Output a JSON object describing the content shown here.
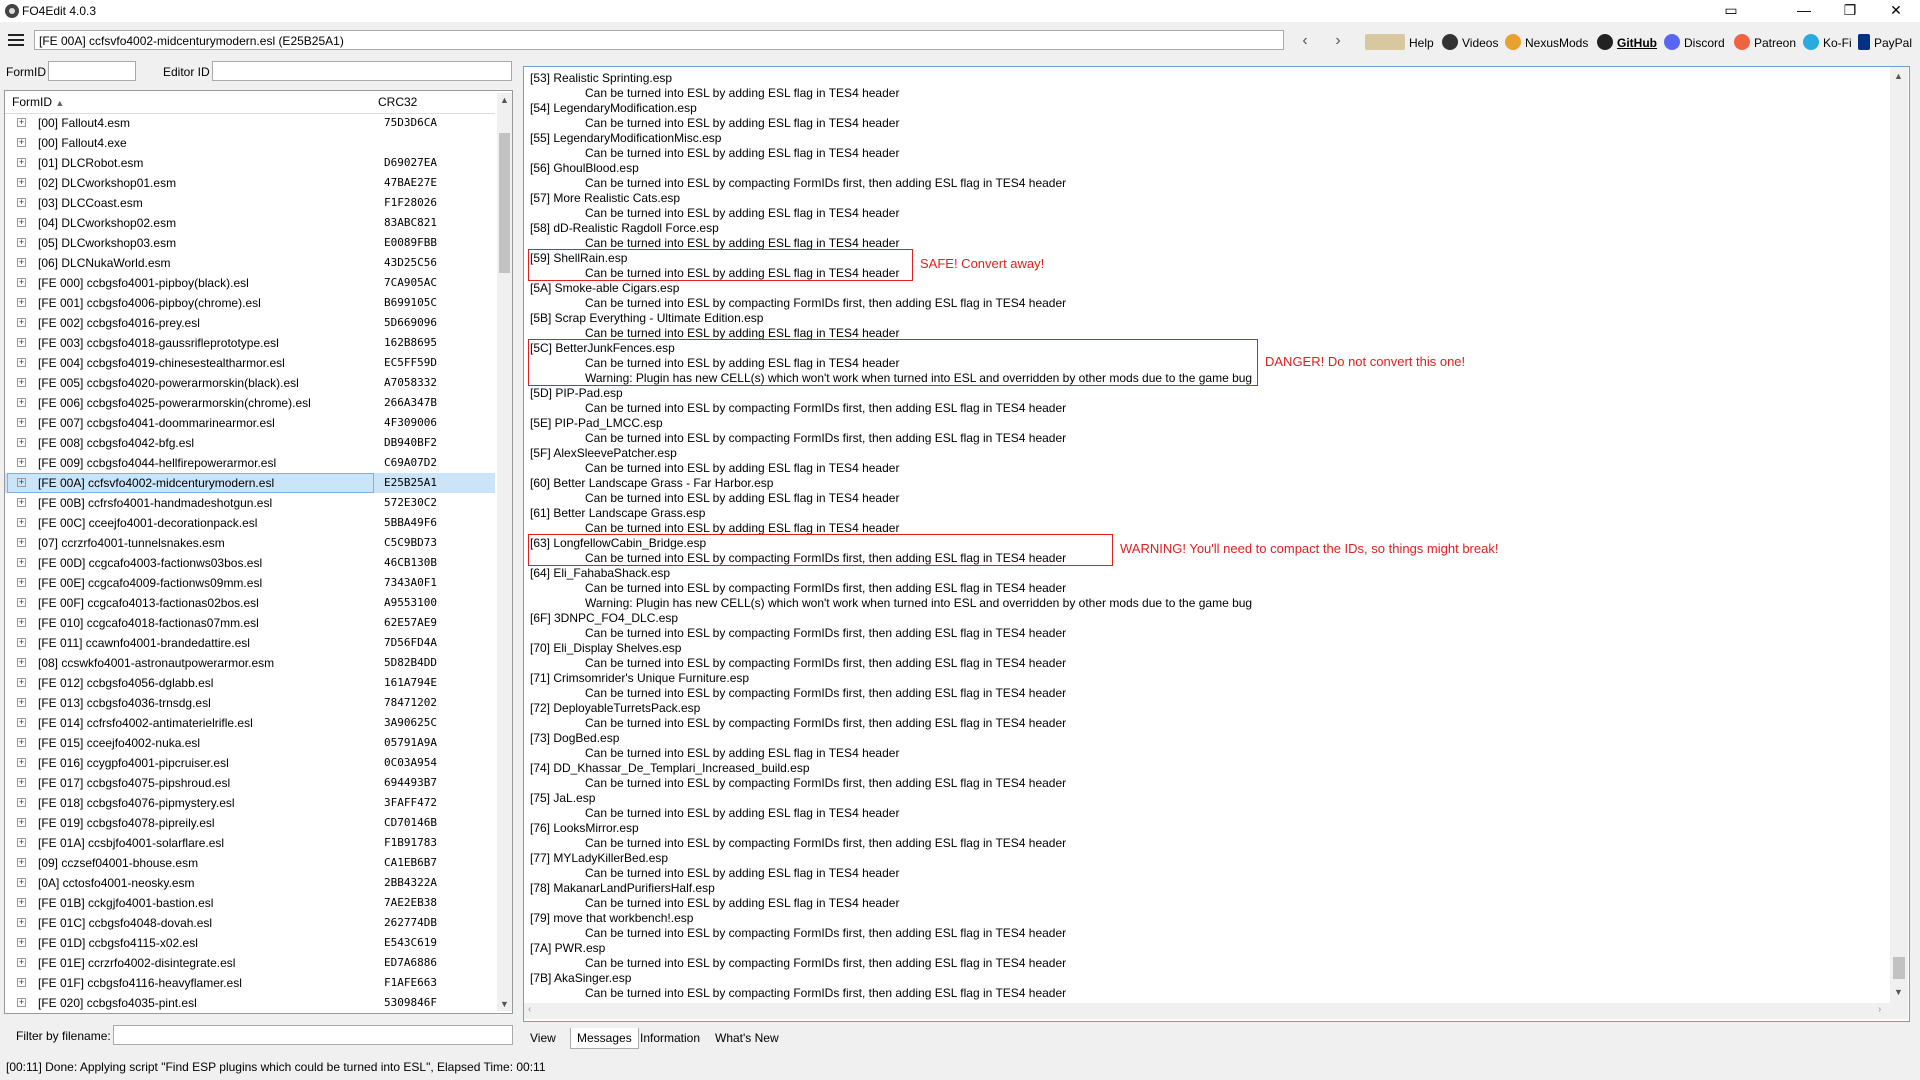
{
  "window": {
    "title": "FO4Edit 4.0.3"
  },
  "toolbar": {
    "path": "[FE 00A] ccfsvfo4002-midcenturymodern.esl (E25B25A1)",
    "links": [
      {
        "label": "Help",
        "icon": "book-icon"
      },
      {
        "label": "Videos",
        "icon": "video-icon"
      },
      {
        "label": "NexusMods",
        "icon": "nexusmods-icon"
      },
      {
        "label": "GitHub",
        "icon": "github-icon"
      },
      {
        "label": "Discord",
        "icon": "discord-icon"
      },
      {
        "label": "Patreon",
        "icon": "patreon-icon"
      },
      {
        "label": "Ko-Fi",
        "icon": "kofi-icon"
      },
      {
        "label": "PayPal",
        "icon": "paypal-icon"
      }
    ]
  },
  "filters": {
    "formid_label": "FormID",
    "editorid_label": "Editor ID",
    "filename_label": "Filter by filename:"
  },
  "tree": {
    "columns": {
      "formid": "FormID",
      "crc": "CRC32"
    },
    "rows": [
      {
        "name": "[00] Fallout4.esm",
        "crc": "75D3D6CA"
      },
      {
        "name": "[00] Fallout4.exe",
        "crc": ""
      },
      {
        "name": "[01] DLCRobot.esm",
        "crc": "D69027EA"
      },
      {
        "name": "[02] DLCworkshop01.esm",
        "crc": "47BAE27E"
      },
      {
        "name": "[03] DLCCoast.esm",
        "crc": "F1F28026"
      },
      {
        "name": "[04] DLCworkshop02.esm",
        "crc": "83ABC821"
      },
      {
        "name": "[05] DLCworkshop03.esm",
        "crc": "E0089FBB"
      },
      {
        "name": "[06] DLCNukaWorld.esm",
        "crc": "43D25C56"
      },
      {
        "name": "[FE 000] ccbgsfo4001-pipboy(black).esl",
        "crc": "7CA905AC"
      },
      {
        "name": "[FE 001] ccbgsfo4006-pipboy(chrome).esl",
        "crc": "B699105C"
      },
      {
        "name": "[FE 002] ccbgsfo4016-prey.esl",
        "crc": "5D669096"
      },
      {
        "name": "[FE 003] ccbgsfo4018-gaussrifleprototype.esl",
        "crc": "162B8695"
      },
      {
        "name": "[FE 004] ccbgsfo4019-chinesestealtharmor.esl",
        "crc": "EC5FF59D"
      },
      {
        "name": "[FE 005] ccbgsfo4020-powerarmorskin(black).esl",
        "crc": "A7058332"
      },
      {
        "name": "[FE 006] ccbgsfo4025-powerarmorskin(chrome).esl",
        "crc": "266A347B"
      },
      {
        "name": "[FE 007] ccbgsfo4041-doommarinearmor.esl",
        "crc": "4F309006"
      },
      {
        "name": "[FE 008] ccbgsfo4042-bfg.esl",
        "crc": "DB940BF2"
      },
      {
        "name": "[FE 009] ccbgsfo4044-hellfirepowerarmor.esl",
        "crc": "C69A07D2"
      },
      {
        "name": "[FE 00A] ccfsvfo4002-midcenturymodern.esl",
        "crc": "E25B25A1"
      },
      {
        "name": "[FE 00B] ccfrsfo4001-handmadeshotgun.esl",
        "crc": "572E30C2"
      },
      {
        "name": "[FE 00C] cceejfo4001-decorationpack.esl",
        "crc": "5BBA49F6"
      },
      {
        "name": "[07] ccrzrfo4001-tunnelsnakes.esm",
        "crc": "C5C9BD73"
      },
      {
        "name": "[FE 00D] ccgcafo4003-factionws03bos.esl",
        "crc": "46CB130B"
      },
      {
        "name": "[FE 00E] ccgcafo4009-factionws09mm.esl",
        "crc": "7343A0F1"
      },
      {
        "name": "[FE 00F] ccgcafo4013-factionas02bos.esl",
        "crc": "A9553100"
      },
      {
        "name": "[FE 010] ccgcafo4018-factionas07mm.esl",
        "crc": "62E57AE9"
      },
      {
        "name": "[FE 011] ccawnfo4001-brandedattire.esl",
        "crc": "7D56FD4A"
      },
      {
        "name": "[08] ccswkfo4001-astronautpowerarmor.esm",
        "crc": "5D82B4DD"
      },
      {
        "name": "[FE 012] ccbgsfo4056-dglabb.esl",
        "crc": "161A794E"
      },
      {
        "name": "[FE 013] ccbgsfo4036-trnsdg.esl",
        "crc": "78471202"
      },
      {
        "name": "[FE 014] ccfrsfo4002-antimaterielrifle.esl",
        "crc": "3A90625C"
      },
      {
        "name": "[FE 015] cceejfo4002-nuka.esl",
        "crc": "05791A9A"
      },
      {
        "name": "[FE 016] ccygpfo4001-pipcruiser.esl",
        "crc": "0C03A954"
      },
      {
        "name": "[FE 017] ccbgsfo4075-pipshroud.esl",
        "crc": "694493B7"
      },
      {
        "name": "[FE 018] ccbgsfo4076-pipmystery.esl",
        "crc": "3FAFF472"
      },
      {
        "name": "[FE 019] ccbgsfo4078-pipreily.esl",
        "crc": "CD70146B"
      },
      {
        "name": "[FE 01A] ccsbjfo4001-solarflare.esl",
        "crc": "F1B91783"
      },
      {
        "name": "[09] cczsef04001-bhouse.esm",
        "crc": "CA1EB6B7"
      },
      {
        "name": "[0A] cctosfo4001-neosky.esm",
        "crc": "2BB4322A"
      },
      {
        "name": "[FE 01B] cckgjfo4001-bastion.esl",
        "crc": "7AE2EB38"
      },
      {
        "name": "[FE 01C] ccbgsfo4048-dovah.esl",
        "crc": "262774DB"
      },
      {
        "name": "[FE 01D] ccbgsfo4115-x02.esl",
        "crc": "E543C619"
      },
      {
        "name": "[FE 01E] ccrzrfo4002-disintegrate.esl",
        "crc": "ED7A6886"
      },
      {
        "name": "[FE 01F] ccbgsfo4116-heavyflamer.esl",
        "crc": "F1AFE663"
      },
      {
        "name": "[FE 020] ccbgsfo4035-pint.esl",
        "crc": "5309846F"
      }
    ]
  },
  "messages": [
    {
      "name": "[53] Realistic Sprinting.esp",
      "lines": [
        "Can be turned into ESL by adding ESL flag in TES4 header"
      ]
    },
    {
      "name": "[54] LegendaryModification.esp",
      "lines": [
        "Can be turned into ESL by adding ESL flag in TES4 header"
      ]
    },
    {
      "name": "[55] LegendaryModificationMisc.esp",
      "lines": [
        "Can be turned into ESL by adding ESL flag in TES4 header"
      ]
    },
    {
      "name": "[56] GhoulBlood.esp",
      "lines": [
        "Can be turned into ESL by compacting FormIDs first, then adding ESL flag in TES4 header"
      ]
    },
    {
      "name": "[57] More Realistic Cats.esp",
      "lines": [
        "Can be turned into ESL by adding ESL flag in TES4 header"
      ]
    },
    {
      "name": "[58] dD-Realistic Ragdoll Force.esp",
      "lines": [
        "Can be turned into ESL by adding ESL flag in TES4 header"
      ]
    },
    {
      "name": "[59] ShellRain.esp",
      "lines": [
        "Can be turned into ESL by adding ESL flag in TES4 header"
      ]
    },
    {
      "name": "[5A] Smoke-able Cigars.esp",
      "lines": [
        "Can be turned into ESL by compacting FormIDs first, then adding ESL flag in TES4 header"
      ]
    },
    {
      "name": "[5B] Scrap Everything - Ultimate Edition.esp",
      "lines": [
        "Can be turned into ESL by adding ESL flag in TES4 header"
      ]
    },
    {
      "name": "[5C] BetterJunkFences.esp",
      "lines": [
        "Can be turned into ESL by adding ESL flag in TES4 header",
        "Warning: Plugin has new CELL(s) which won't work when turned into ESL and overridden by other mods due to the game bug"
      ]
    },
    {
      "name": "[5D] PIP-Pad.esp",
      "lines": [
        "Can be turned into ESL by compacting FormIDs first, then adding ESL flag in TES4 header"
      ]
    },
    {
      "name": "[5E] PIP-Pad_LMCC.esp",
      "lines": [
        "Can be turned into ESL by compacting FormIDs first, then adding ESL flag in TES4 header"
      ]
    },
    {
      "name": "[5F] AlexSleevePatcher.esp",
      "lines": [
        "Can be turned into ESL by adding ESL flag in TES4 header"
      ]
    },
    {
      "name": "[60] Better Landscape Grass - Far Harbor.esp",
      "lines": [
        "Can be turned into ESL by adding ESL flag in TES4 header"
      ]
    },
    {
      "name": "[61] Better Landscape Grass.esp",
      "lines": [
        "Can be turned into ESL by adding ESL flag in TES4 header"
      ]
    },
    {
      "name": "[63] LongfellowCabin_Bridge.esp",
      "lines": [
        "Can be turned into ESL by compacting FormIDs first, then adding ESL flag in TES4 header"
      ]
    },
    {
      "name": "[64] Eli_FahabaShack.esp",
      "lines": [
        "Can be turned into ESL by compacting FormIDs first, then adding ESL flag in TES4 header",
        "Warning: Plugin has new CELL(s) which won't work when turned into ESL and overridden by other mods due to the game bug"
      ]
    },
    {
      "name": "[6F] 3DNPC_FO4_DLC.esp",
      "lines": [
        "Can be turned into ESL by compacting FormIDs first, then adding ESL flag in TES4 header"
      ]
    },
    {
      "name": "[70] Eli_Display Shelves.esp",
      "lines": [
        "Can be turned into ESL by compacting FormIDs first, then adding ESL flag in TES4 header"
      ]
    },
    {
      "name": "[71] Crimsomrider's Unique Furniture.esp",
      "lines": [
        "Can be turned into ESL by compacting FormIDs first, then adding ESL flag in TES4 header"
      ]
    },
    {
      "name": "[72] DeployableTurretsPack.esp",
      "lines": [
        "Can be turned into ESL by compacting FormIDs first, then adding ESL flag in TES4 header"
      ]
    },
    {
      "name": "[73] DogBed.esp",
      "lines": [
        "Can be turned into ESL by adding ESL flag in TES4 header"
      ]
    },
    {
      "name": "[74] DD_Khassar_De_Templari_Increased_build.esp",
      "lines": [
        "Can be turned into ESL by compacting FormIDs first, then adding ESL flag in TES4 header"
      ]
    },
    {
      "name": "[75] JaL.esp",
      "lines": [
        "Can be turned into ESL by adding ESL flag in TES4 header"
      ]
    },
    {
      "name": "[76] LooksMirror.esp",
      "lines": [
        "Can be turned into ESL by compacting FormIDs first, then adding ESL flag in TES4 header"
      ]
    },
    {
      "name": "[77] MYLadyKillerBed.esp",
      "lines": [
        "Can be turned into ESL by adding ESL flag in TES4 header"
      ]
    },
    {
      "name": "[78] MakanarLandPurifiersHalf.esp",
      "lines": [
        "Can be turned into ESL by adding ESL flag in TES4 header"
      ]
    },
    {
      "name": "[79] move that workbench!.esp",
      "lines": [
        "Can be turned into ESL by compacting FormIDs first, then adding ESL flag in TES4 header"
      ]
    },
    {
      "name": "[7A] PWR.esp",
      "lines": [
        "Can be turned into ESL by compacting FormIDs first, then adding ESL flag in TES4 header"
      ]
    },
    {
      "name": "[7B] AkaSinger.esp",
      "lines": [
        "Can be turned into ESL by compacting FormIDs first, then adding ESL flag in TES4 header"
      ]
    }
  ],
  "annotations": [
    {
      "text": "SAFE! Convert away!",
      "entry": 6
    },
    {
      "text": "DANGER! Do not convert this one!",
      "entry": 9
    },
    {
      "text": "WARNING! You'll need to compact the IDs, so things might break!",
      "entry": 15
    }
  ],
  "tabs": [
    "View",
    "Messages",
    "Information",
    "What's New"
  ],
  "status": "[00:11] Done: Applying script \"Find ESP plugins which could be turned into ESL\", Elapsed Time: 00:11",
  "colors": {
    "annotation": "#e02020",
    "selection": "#cce4f7"
  }
}
